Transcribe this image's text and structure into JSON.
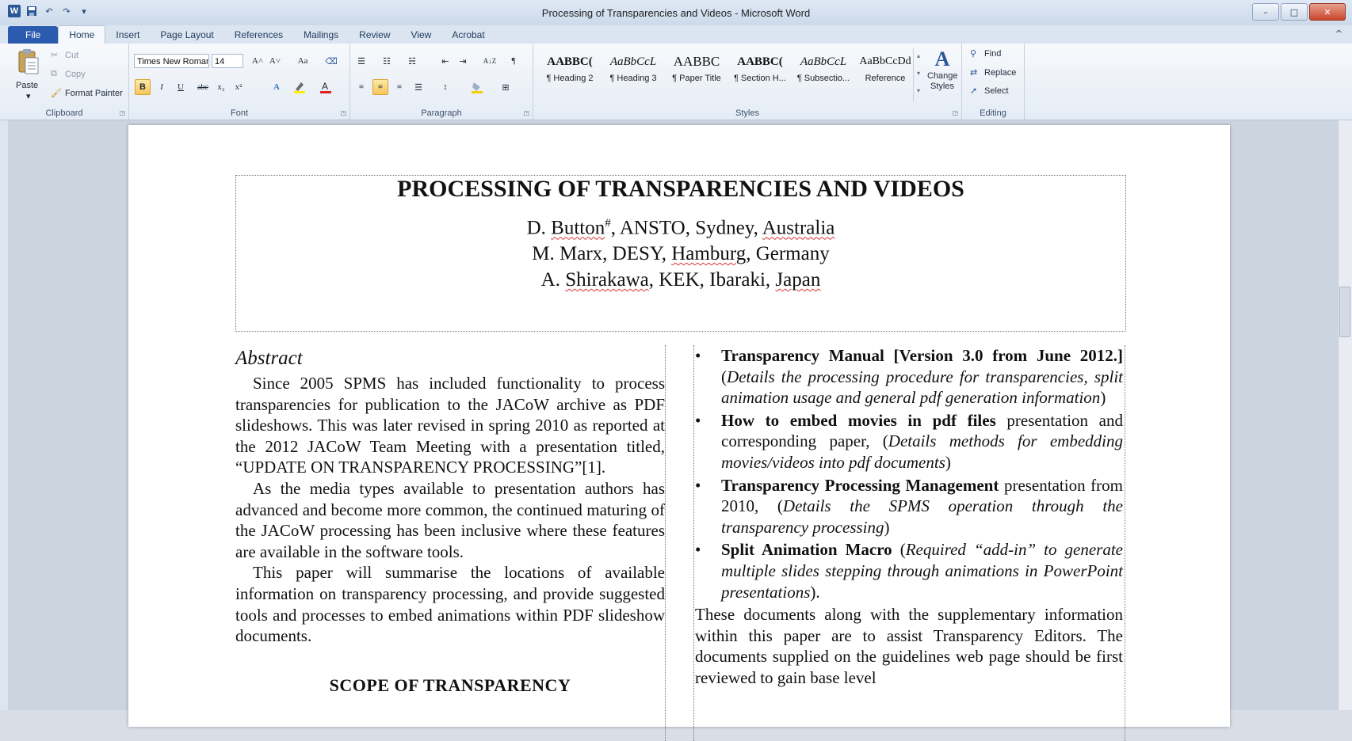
{
  "window": {
    "title": "Processing of Transparencies and Videos - Microsoft Word",
    "controls": {
      "minimize": "–",
      "maximize": "□",
      "close": "✕"
    }
  },
  "quick_access": {
    "app_icon": "W",
    "save_icon": "save-icon",
    "undo_icon": "undo-icon",
    "redo_icon": "redo-icon"
  },
  "tabs": [
    "File",
    "Home",
    "Insert",
    "Page Layout",
    "References",
    "Mailings",
    "Review",
    "View",
    "Acrobat"
  ],
  "active_tab": "Home",
  "help_glyph": "^",
  "ribbon": {
    "clipboard": {
      "paste": "Paste",
      "cut": "Cut",
      "copy": "Copy",
      "format_painter": "Format Painter",
      "label": "Clipboard"
    },
    "font": {
      "name": "Times New Roman",
      "size": "14",
      "label": "Font",
      "grow": "A˄",
      "shrink": "A˅",
      "change_case": "Aa",
      "bold": "B",
      "italic": "I",
      "underline": "U",
      "strike": "abc",
      "subscript": "x₂",
      "superscript": "x²"
    },
    "paragraph": {
      "label": "Paragraph",
      "sort": "A↓Z",
      "pilcrow": "¶"
    },
    "styles": {
      "label": "Styles",
      "items": [
        {
          "sample": "AABBC(",
          "name": "¶ Heading 2",
          "style": "bold"
        },
        {
          "sample": "AaBbCcL",
          "name": "¶ Heading 3",
          "style": "italic"
        },
        {
          "sample": "AABBC",
          "name": "¶ Paper Title",
          "style": "normal"
        },
        {
          "sample": "AABBC(",
          "name": "¶ Section H...",
          "style": "bold"
        },
        {
          "sample": "AaBbCcL",
          "name": "¶ Subsectio...",
          "style": "italic"
        },
        {
          "sample": "AaBbCcDd",
          "name": "Reference",
          "style": "normal"
        }
      ],
      "change_styles": "Change Styles"
    },
    "editing": {
      "find": "Find",
      "replace": "Replace",
      "select": "Select",
      "label": "Editing"
    }
  },
  "document": {
    "title": "PROCESSING OF TRANSPARENCIES AND VIDEOS",
    "authors": [
      {
        "pre": "D. ",
        "name": "Button",
        "sup": "#",
        "post": ", ANSTO, Sydney, ",
        "place": "Australia"
      },
      {
        "pre": "M. Marx, DESY, ",
        "name": "Hamburg",
        "sup": "",
        "post": ", Germany",
        "place": ""
      },
      {
        "pre": "A. ",
        "name": "Shirakawa",
        "sup": "",
        "post": ", KEK, Ibaraki, ",
        "place": "Japan"
      }
    ],
    "abstract_heading": "Abstract",
    "abstract_paragraphs": [
      "Since 2005 SPMS has included functionality to process transparencies for publication to the JACoW archive as PDF slideshows. This was later revised in spring 2010 as reported at the 2012 JACoW Team Meeting with a presentation titled, “UPDATE ON TRANSPARENCY PROCESSING”[1].",
      "As the media types available to presentation authors has advanced and become more common, the continued maturing of the JACoW processing has been inclusive where these features are available in the software tools.",
      "This paper will summarise the locations of available information on transparency processing, and provide suggested tools and processes to embed animations within PDF slideshow documents."
    ],
    "section_heading": "SCOPE OF TRANSPARENCY",
    "bullets": [
      {
        "bold": "Transparency Manual [Version 3.0 from June 2012.]",
        "plain": " (",
        "italic": "Details the processing procedure for transparencies, split animation usage and general pdf generation information",
        "end": ")"
      },
      {
        "bold": "How to embed movies in pdf files",
        "plain": " presentation and corresponding paper, (",
        "italic": "Details methods for embedding movies/videos into pdf documents",
        "end": ")"
      },
      {
        "bold": "Transparency Processing Management",
        "plain": " presentation from 2010, (",
        "italic": "Details the SPMS operation through the transparency processing",
        "end": ")"
      },
      {
        "bold": "Split Animation Macro",
        "plain": " (",
        "italic": "Required “add-in” to generate multiple slides stepping through animations in PowerPoint presentations",
        "end": ")."
      }
    ],
    "closing_paragraph": "These documents along with the supplementary information within this paper are to assist Transparency Editors. The documents supplied on the guidelines web page should be first reviewed to gain base level"
  },
  "colors": {
    "file_tab": "#2a5bae",
    "ribbon_bg": "#e5ecf5",
    "workspace_bg": "#ccd4e0",
    "spell_error": "#dd3333"
  }
}
